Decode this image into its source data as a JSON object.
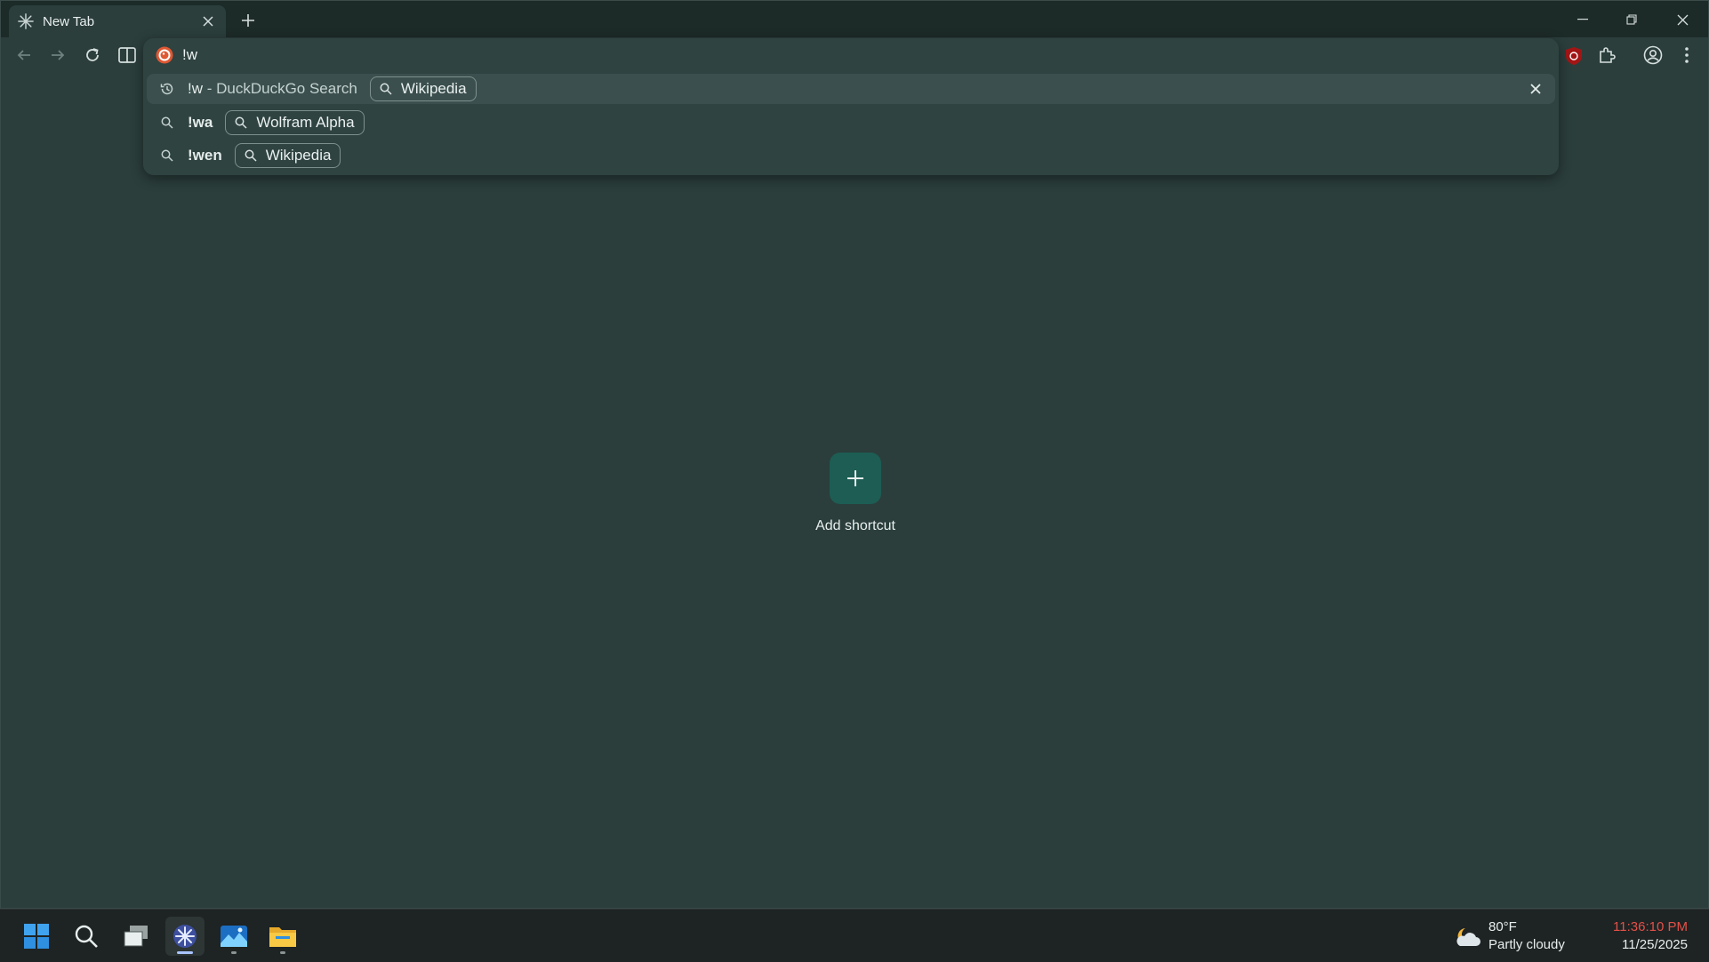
{
  "tab": {
    "title": "New Tab"
  },
  "omnibox": {
    "input_value": "!w",
    "suggestions": [
      {
        "text": "!w",
        "suffix": " - DuckDuckGo Search",
        "chip": "Wikipedia",
        "kind": "history"
      },
      {
        "text": "!wa",
        "suffix": "",
        "chip": "Wolfram Alpha",
        "kind": "search"
      },
      {
        "text": "!wen",
        "suffix": "",
        "chip": "Wikipedia",
        "kind": "search"
      }
    ]
  },
  "content": {
    "shortcut_label": "Add shortcut"
  },
  "taskbar": {
    "weather": {
      "temp": "80°F",
      "condition": "Partly cloudy"
    },
    "clock": {
      "time": "11:36:10 PM",
      "date": "11/25/2025"
    }
  },
  "colors": {
    "accent_tile": "#1d5d54",
    "page_bg": "#2b3e3c",
    "clock_time": "#e45049"
  }
}
